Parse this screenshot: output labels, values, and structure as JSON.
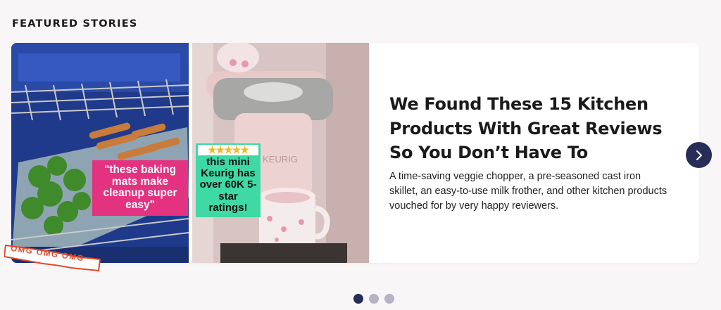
{
  "section": {
    "title": "FEATURED STORIES"
  },
  "story": {
    "headline": "We Found These 15 Kitchen Products With Great Reviews So You Don’t Have To",
    "description": "A time-saving veggie chopper, a pre-seasoned cast iron skillet, an easy-to-use milk frother, and other kitchen products vouched for by very happy reviewers.",
    "left_image_caption": "\"these baking mats make cleanup super easy\"",
    "right_image_caption": "this mini Keurig has over 60K 5-star ratings!",
    "right_image_rating": "★★★★★",
    "keurig_logo_text": "KEURIG",
    "sticker": "OMG OMG OMG"
  },
  "carousel": {
    "next_icon": "chevron-right-icon",
    "dots": [
      true,
      false,
      false
    ],
    "colors": {
      "active": "#262d58",
      "inactive": "#b7b3c4"
    }
  },
  "colors": {
    "pink_label": "#e3327f",
    "green_label": "#3ed9a5",
    "sticker": "#e04a2a",
    "button": "#262d58"
  }
}
